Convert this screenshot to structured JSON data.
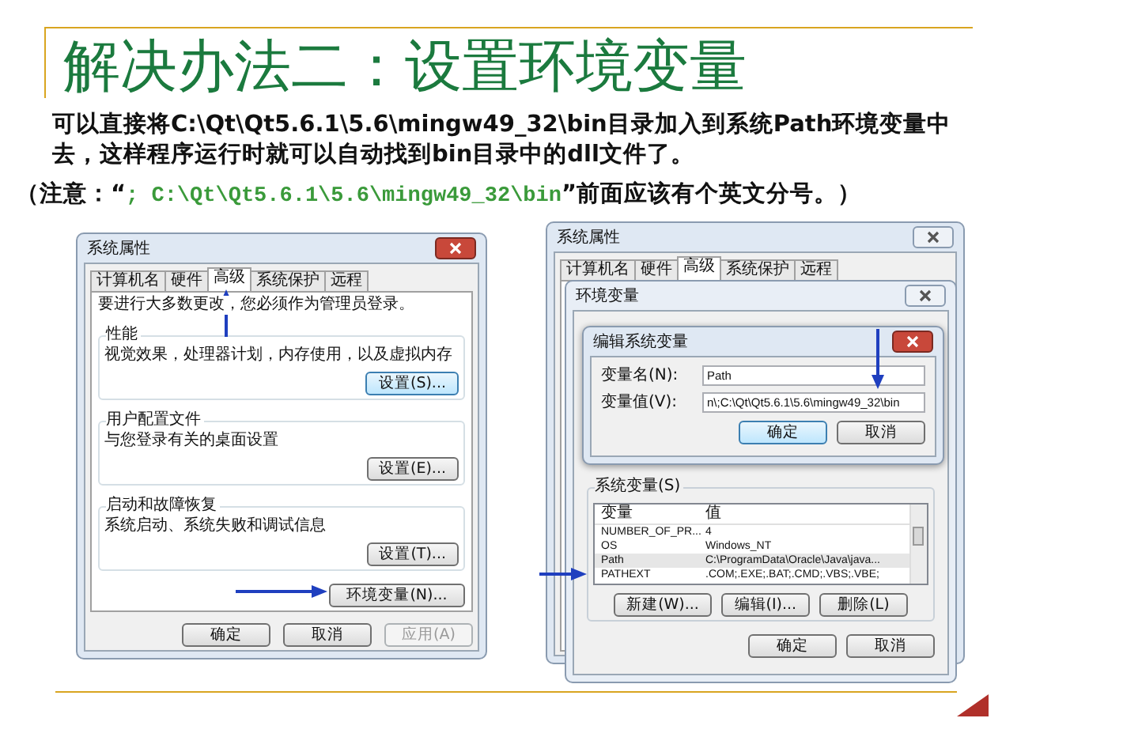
{
  "slide": {
    "title": "解决办法二：设置环境变量",
    "body": "可以直接将C:\\Qt\\Qt5.6.1\\5.6\\mingw49_32\\bin目录加入到系统Path环境变量中去，这样程序运行时就可以自动找到bin目录中的dll文件了。",
    "note": [
      {
        "kind": "plain",
        "text": "（注意：“"
      },
      {
        "kind": "highlight",
        "text": "; C:\\Qt\\Qt5.6.1\\5.6\\mingw49_32\\bin"
      },
      {
        "kind": "plain",
        "text": "”前面应该有个英文分号。）"
      }
    ]
  },
  "system_properties": {
    "title": "系统属性",
    "tabs": [
      {
        "label": "计算机名",
        "selected": false
      },
      {
        "label": "硬件",
        "selected": false
      },
      {
        "label": "高级",
        "selected": true
      },
      {
        "label": "系统保护",
        "selected": false
      },
      {
        "label": "远程",
        "selected": false
      }
    ],
    "notice": "要进行大多数更改，您必须作为管理员登录。",
    "groups": [
      {
        "title": "性能",
        "description": "视觉效果，处理器计划，内存使用，以及虚拟内存",
        "button": "设置(S)...",
        "focused": true
      },
      {
        "title": "用户配置文件",
        "description": "与您登录有关的桌面设置",
        "button": "设置(E)...",
        "focused": false
      },
      {
        "title": "启动和故障恢复",
        "description": "系统启动、系统失败和调试信息",
        "button": "设置(T)...",
        "focused": false
      }
    ],
    "env_button": "环境变量(N)...",
    "buttons": [
      {
        "label": "确定",
        "disabled": false
      },
      {
        "label": "取消",
        "disabled": false
      },
      {
        "label": "应用(A)",
        "disabled": true
      }
    ]
  },
  "system_properties_behind": {
    "title": "系统属性",
    "tabs": [
      {
        "label": "计算机名",
        "selected": false
      },
      {
        "label": "硬件",
        "selected": false
      },
      {
        "label": "高级",
        "selected": true
      },
      {
        "label": "系统保护",
        "selected": false
      },
      {
        "label": "远程",
        "selected": false
      }
    ]
  },
  "environment_variables": {
    "title": "环境变量",
    "system_variables": {
      "label": "系统变量(S)",
      "columns": [
        "变量",
        "值"
      ],
      "rows": [
        {
          "name": "NUMBER_OF_PR...",
          "value": "4",
          "selected": false
        },
        {
          "name": "OS",
          "value": "Windows_NT",
          "selected": false
        },
        {
          "name": "Path",
          "value": "C:\\ProgramData\\Oracle\\Java\\java...",
          "selected": true
        },
        {
          "name": "PATHEXT",
          "value": ".COM;.EXE;.BAT;.CMD;.VBS;.VBE;",
          "selected": false
        }
      ],
      "buttons": [
        "新建(W)...",
        "编辑(I)...",
        "删除(L)"
      ]
    },
    "buttons": [
      "确定",
      "取消"
    ]
  },
  "edit_dialog": {
    "title": "编辑系统变量",
    "fields": [
      {
        "label": "变量名(N):",
        "value": "Path"
      },
      {
        "label": "变量值(V):",
        "value": "n\\;C:\\Qt\\Qt5.6.1\\5.6\\mingw49_32\\bin"
      }
    ],
    "buttons": [
      {
        "label": "确定",
        "default": true
      },
      {
        "label": "取消",
        "default": false
      }
    ]
  }
}
